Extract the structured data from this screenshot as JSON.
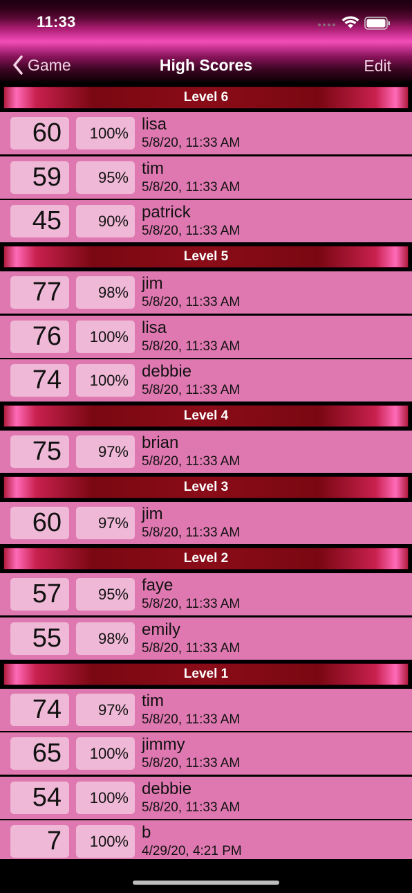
{
  "status_bar": {
    "time": "11:33"
  },
  "nav": {
    "back_label": "Game",
    "title": "High Scores",
    "edit_label": "Edit"
  },
  "sections": [
    {
      "title": "Level 6",
      "rows": [
        {
          "score": "60",
          "percent": "100%",
          "name": "lisa",
          "date": "5/8/20, 11:33 AM"
        },
        {
          "score": "59",
          "percent": "95%",
          "name": "tim",
          "date": "5/8/20, 11:33 AM"
        },
        {
          "score": "45",
          "percent": "90%",
          "name": "patrick",
          "date": "5/8/20, 11:33 AM"
        }
      ]
    },
    {
      "title": "Level 5",
      "rows": [
        {
          "score": "77",
          "percent": "98%",
          "name": "jim",
          "date": "5/8/20, 11:33 AM"
        },
        {
          "score": "76",
          "percent": "100%",
          "name": "lisa",
          "date": "5/8/20, 11:33 AM"
        },
        {
          "score": "74",
          "percent": "100%",
          "name": "debbie",
          "date": "5/8/20, 11:33 AM"
        }
      ]
    },
    {
      "title": "Level 4",
      "rows": [
        {
          "score": "75",
          "percent": "97%",
          "name": "brian",
          "date": "5/8/20, 11:33 AM"
        }
      ]
    },
    {
      "title": "Level 3",
      "rows": [
        {
          "score": "60",
          "percent": "97%",
          "name": "jim",
          "date": "5/8/20, 11:33 AM"
        }
      ]
    },
    {
      "title": "Level 2",
      "rows": [
        {
          "score": "57",
          "percent": "95%",
          "name": "faye",
          "date": "5/8/20, 11:33 AM"
        },
        {
          "score": "55",
          "percent": "98%",
          "name": "emily",
          "date": "5/8/20, 11:33 AM"
        }
      ]
    },
    {
      "title": "Level 1",
      "rows": [
        {
          "score": "74",
          "percent": "97%",
          "name": "tim",
          "date": "5/8/20, 11:33 AM"
        },
        {
          "score": "65",
          "percent": "100%",
          "name": "jimmy",
          "date": "5/8/20, 11:33 AM"
        },
        {
          "score": "54",
          "percent": "100%",
          "name": "debbie",
          "date": "5/8/20, 11:33 AM"
        },
        {
          "score": "7",
          "percent": "100%",
          "name": "b",
          "date": "4/29/20, 4:21 PM"
        }
      ]
    }
  ],
  "icons": {
    "back": "chevron-left-icon",
    "wifi": "wifi-icon",
    "battery": "battery-icon",
    "signal": "cellular-signal-icon"
  },
  "colors": {
    "row_bg": "#df78b0",
    "box_bg": "#efb8d6",
    "header_pink": "#f24fb8",
    "section_red": "#8a0c18"
  }
}
